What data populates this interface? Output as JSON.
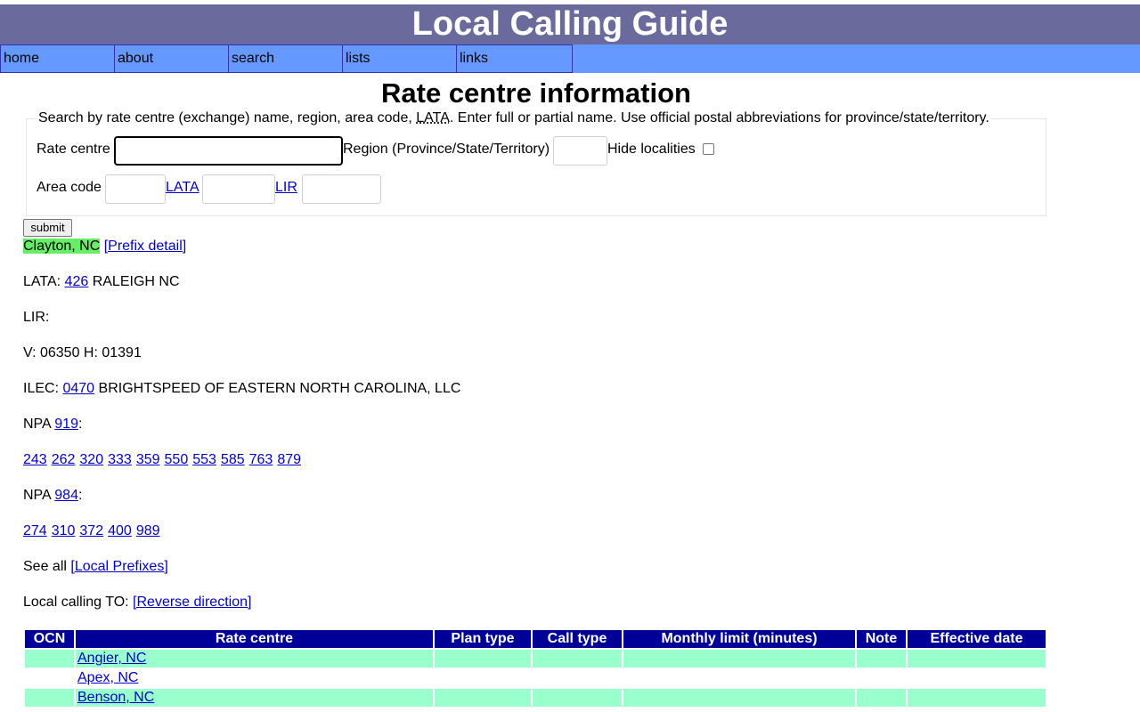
{
  "header": {
    "title": "Local Calling Guide"
  },
  "nav": {
    "items": [
      {
        "label": "home"
      },
      {
        "label": "about"
      },
      {
        "label": "search"
      },
      {
        "label": "lists"
      },
      {
        "label": "links"
      }
    ]
  },
  "page_title": "Rate centre information",
  "search_form": {
    "legend_before": "Search by rate centre (exchange) name, region, area code, ",
    "legend_abbr": "LATA",
    "legend_after": ". Enter full or partial name. Use official postal abbreviations for province/state/territory.",
    "rate_centre_label": "Rate centre",
    "rate_centre_value": "",
    "region_label": "Region (Province/State/Territory)",
    "region_value": "",
    "hide_localities_label": "Hide localities",
    "hide_localities_checked": false,
    "area_code_label": "Area code",
    "area_code_value": "",
    "lata_link": "LATA",
    "lata_value": "",
    "lir_link": "LIR",
    "lir_value": "",
    "submit_label": "submit"
  },
  "rate_centre": {
    "name": "Clayton, NC",
    "prefix_detail_link": "[Prefix detail]",
    "lata_label": "LATA:",
    "lata_code": "426",
    "lata_name": "RALEIGH NC",
    "lir_label": "LIR:",
    "vh_text": "V: 06350 H: 01391",
    "ilec_label": "ILEC:",
    "ilec_code": "0470",
    "ilec_name": "BRIGHTSPEED OF EASTERN NORTH CAROLINA, LLC",
    "npa_label": "NPA",
    "npas": [
      {
        "npa": "919",
        "prefixes": [
          "243",
          "262",
          "320",
          "333",
          "359",
          "550",
          "553",
          "585",
          "763",
          "879"
        ]
      },
      {
        "npa": "984",
        "prefixes": [
          "274",
          "310",
          "372",
          "400",
          "989"
        ]
      }
    ],
    "see_all_label": "See all",
    "local_prefixes_link": "[Local Prefixes]",
    "local_calling_label": "Local calling TO:",
    "reverse_direction_link": "[Reverse direction]"
  },
  "table": {
    "headers": [
      "OCN",
      "Rate centre",
      "Plan type",
      "Call type",
      "Monthly limit (minutes)",
      "Note",
      "Effective date"
    ],
    "rows": [
      {
        "ocn": "",
        "rate_centre": "Angier, NC",
        "plan_type": "",
        "call_type": "",
        "monthly_limit": "",
        "note": "",
        "effective_date": ""
      },
      {
        "ocn": "",
        "rate_centre": "Apex, NC",
        "plan_type": "",
        "call_type": "",
        "monthly_limit": "",
        "note": "",
        "effective_date": ""
      },
      {
        "ocn": "",
        "rate_centre": "Benson, NC",
        "plan_type": "",
        "call_type": "",
        "monthly_limit": "",
        "note": "",
        "effective_date": ""
      }
    ]
  },
  "colors": {
    "header_bg": "#6a6a9c",
    "nav_bg": "#6699ff",
    "table_header_bg": "#000099",
    "row_highlight": "#99ffcc",
    "name_highlight": "#66ee66"
  }
}
